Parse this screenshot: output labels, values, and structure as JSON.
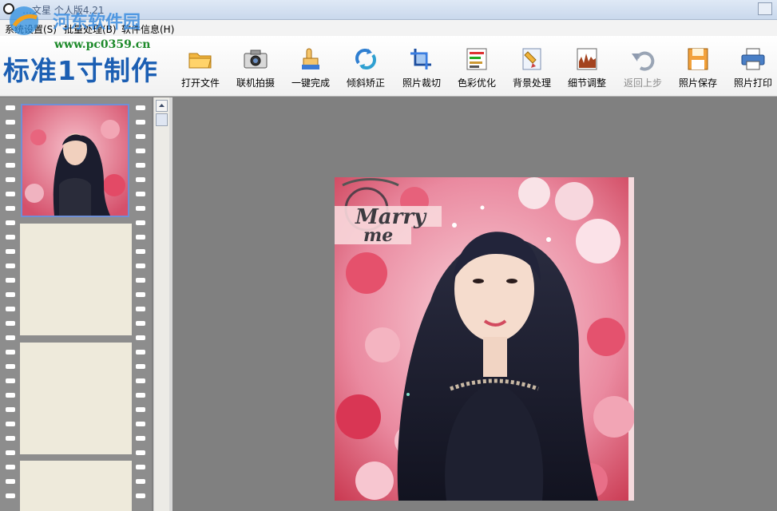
{
  "window": {
    "title": "…文星 个人版4.21"
  },
  "watermark": {
    "site_name": "河东软件园",
    "url": "www.pc0359.cn"
  },
  "menubar": {
    "items": [
      "系统设置(S)",
      "批量处理(B)",
      "软件信息(H)"
    ]
  },
  "banner": {
    "text": "标准1寸制作"
  },
  "toolbar": {
    "tools": [
      {
        "label": "打开文件",
        "icon": "folder-open-icon",
        "enabled": true
      },
      {
        "label": "联机拍摄",
        "icon": "camera-icon",
        "enabled": true
      },
      {
        "label": "一键完成",
        "icon": "hand-pointer-icon",
        "enabled": true
      },
      {
        "label": "倾斜矫正",
        "icon": "rotate-arrows-icon",
        "enabled": true
      },
      {
        "label": "照片裁切",
        "icon": "crop-icon",
        "enabled": true
      },
      {
        "label": "色彩优化",
        "icon": "color-bars-icon",
        "enabled": true
      },
      {
        "label": "背景处理",
        "icon": "brush-icon",
        "enabled": true
      },
      {
        "label": "细节调整",
        "icon": "histogram-icon",
        "enabled": true
      },
      {
        "label": "返回上步",
        "icon": "undo-arrow-icon",
        "enabled": false
      },
      {
        "label": "照片保存",
        "icon": "floppy-disk-icon",
        "enabled": true
      },
      {
        "label": "照片打印",
        "icon": "printer-icon",
        "enabled": true
      }
    ]
  },
  "photo": {
    "overlay_text_1": "Marry",
    "overlay_text_2": "me"
  },
  "filmstrip": {
    "frames": 4,
    "selected_index": 0
  }
}
